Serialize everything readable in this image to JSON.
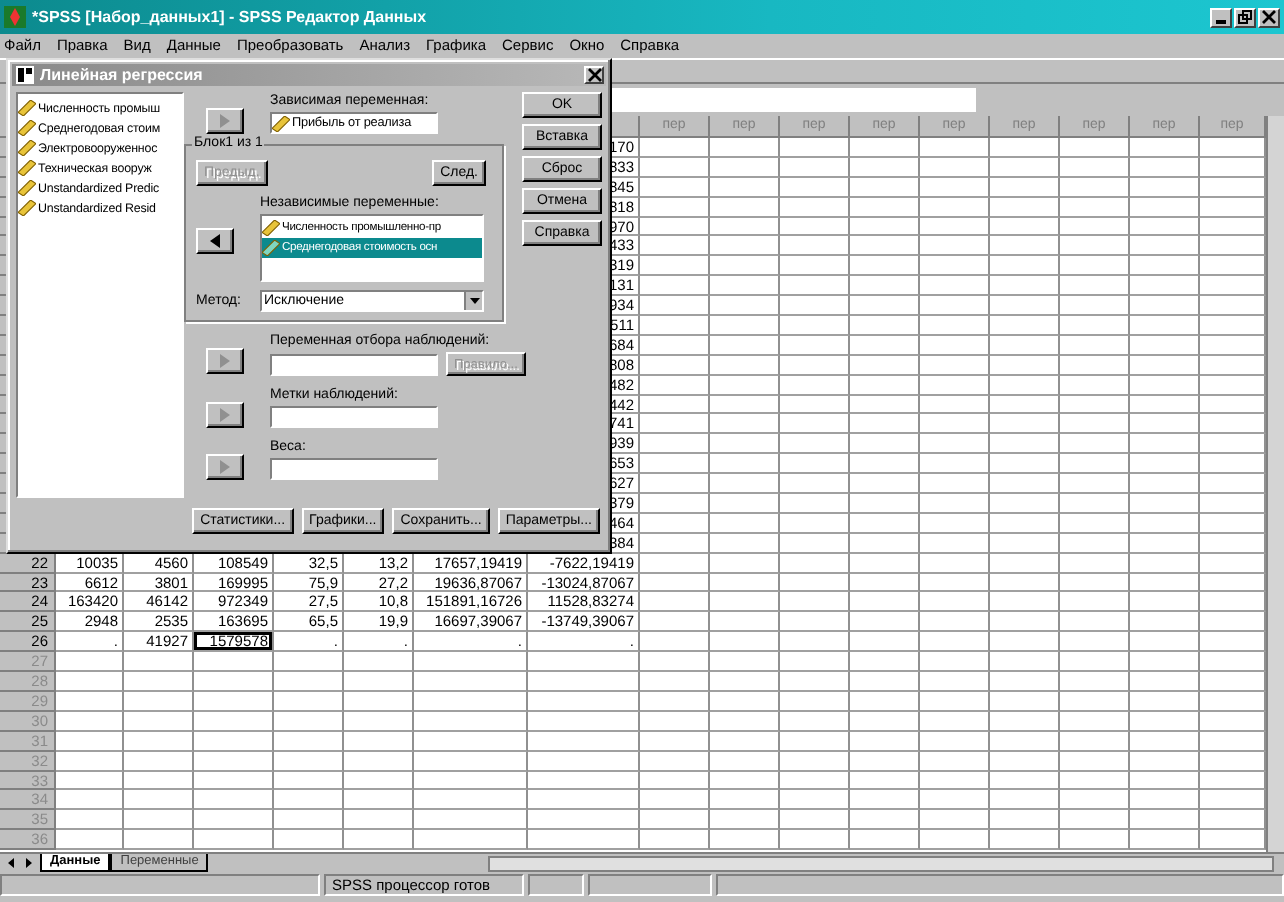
{
  "window": {
    "title": "*SPSS [Набор_данных1] - SPSS Редактор Данных"
  },
  "menu": [
    "Файл",
    "Правка",
    "Вид",
    "Данные",
    "Преобразовать",
    "Анализ",
    "Графика",
    "Сервис",
    "Окно",
    "Справка"
  ],
  "table": {
    "extra_columns": [
      "пер",
      "пер",
      "пер",
      "пер",
      "пер",
      "пер",
      "пер",
      "пер",
      "пер"
    ],
    "hidden_row_tails": [
      "170",
      "833",
      "845",
      "818",
      "970",
      "433",
      "319",
      "131",
      "934",
      "511",
      "684",
      "808",
      "482",
      "442",
      "741",
      "939",
      "653",
      "627",
      "379",
      "464",
      "384"
    ],
    "rows": [
      {
        "number": "22",
        "filled": true,
        "cells": [
          {
            "text": "10035",
            "selected": false
          },
          {
            "text": "4560",
            "selected": false
          },
          {
            "text": "108549",
            "selected": false
          },
          {
            "text": "32,5",
            "selected": false
          },
          {
            "text": "13,2",
            "selected": false
          },
          {
            "text": "17657,19419",
            "selected": false
          },
          {
            "text": "-7622,19419",
            "selected": false
          }
        ]
      },
      {
        "number": "23",
        "filled": true,
        "cells": [
          {
            "text": "6612",
            "selected": false
          },
          {
            "text": "3801",
            "selected": false
          },
          {
            "text": "169995",
            "selected": false
          },
          {
            "text": "75,9",
            "selected": false
          },
          {
            "text": "27,2",
            "selected": false
          },
          {
            "text": "19636,87067",
            "selected": false
          },
          {
            "text": "-13024,87067",
            "selected": false
          }
        ]
      },
      {
        "number": "24",
        "filled": true,
        "cells": [
          {
            "text": "163420",
            "selected": false
          },
          {
            "text": "46142",
            "selected": false
          },
          {
            "text": "972349",
            "selected": false
          },
          {
            "text": "27,5",
            "selected": false
          },
          {
            "text": "10,8",
            "selected": false
          },
          {
            "text": "151891,16726",
            "selected": false
          },
          {
            "text": "11528,83274",
            "selected": false
          }
        ]
      },
      {
        "number": "25",
        "filled": true,
        "cells": [
          {
            "text": "2948",
            "selected": false
          },
          {
            "text": "2535",
            "selected": false
          },
          {
            "text": "163695",
            "selected": false
          },
          {
            "text": "65,5",
            "selected": false
          },
          {
            "text": "19,9",
            "selected": false
          },
          {
            "text": "16697,39067",
            "selected": false
          },
          {
            "text": "-13749,39067",
            "selected": false
          }
        ]
      },
      {
        "number": "26",
        "filled": true,
        "cells": [
          {
            "text": ".",
            "selected": false
          },
          {
            "text": "41927",
            "selected": false
          },
          {
            "text": "1579578",
            "selected": true
          },
          {
            "text": ".",
            "selected": false
          },
          {
            "text": ".",
            "selected": false
          },
          {
            "text": ".",
            "selected": false
          },
          {
            "text": ".",
            "selected": false
          }
        ]
      },
      {
        "number": "27",
        "filled": false,
        "cells": []
      },
      {
        "number": "28",
        "filled": false,
        "cells": []
      },
      {
        "number": "29",
        "filled": false,
        "cells": []
      },
      {
        "number": "30",
        "filled": false,
        "cells": []
      },
      {
        "number": "31",
        "filled": false,
        "cells": []
      },
      {
        "number": "32",
        "filled": false,
        "cells": []
      },
      {
        "number": "33",
        "filled": false,
        "cells": []
      },
      {
        "number": "34",
        "filled": false,
        "cells": []
      },
      {
        "number": "35",
        "filled": false,
        "cells": []
      },
      {
        "number": "36",
        "filled": false,
        "cells": []
      }
    ]
  },
  "sheet_tabs": [
    {
      "label": "Данные",
      "selected": true
    },
    {
      "label": "Переменные",
      "selected": false
    }
  ],
  "status_bar": {
    "text": "SPSS процессор готов"
  },
  "dialog": {
    "title": "Линейная регрессия",
    "variables": [
      "Численность промыш",
      "Среднегодовая стоим",
      "Электровооруженнос",
      "Техническая вооруж",
      "Unstandardized Predic",
      "Unstandardized Resid"
    ],
    "dependent": {
      "label": "Зависимая переменная:",
      "value": "Прибыль от реализа",
      "arrow_disabled": true
    },
    "block": {
      "label": "Блок1 из 1",
      "prev": {
        "label": "Предыд.",
        "disabled": true
      },
      "next": {
        "label": "След.",
        "disabled": false
      }
    },
    "independent": {
      "label": "Независимые переменные:",
      "arrow_disabled": false,
      "items": [
        {
          "text": "Численность промышленно-пр",
          "selected": false
        },
        {
          "text": "Среднегодовая стоимость осн",
          "selected": true
        }
      ]
    },
    "method": {
      "label": "Метод:",
      "value": "Исключение"
    },
    "selection": {
      "label": "Переменная отбора наблюдений:",
      "arrow_disabled": true,
      "rule": {
        "label": "Правило...",
        "disabled": true
      }
    },
    "case_labels": {
      "label": "Метки наблюдений:",
      "arrow_disabled": true
    },
    "weights": {
      "label": "Веса:",
      "arrow_disabled": true
    },
    "side_buttons": [
      "OK",
      "Вставка",
      "Сброс",
      "Отмена",
      "Справка"
    ],
    "bottom_buttons": [
      "Статистики...",
      "Графики...",
      "Сохранить...",
      "Параметры..."
    ]
  }
}
